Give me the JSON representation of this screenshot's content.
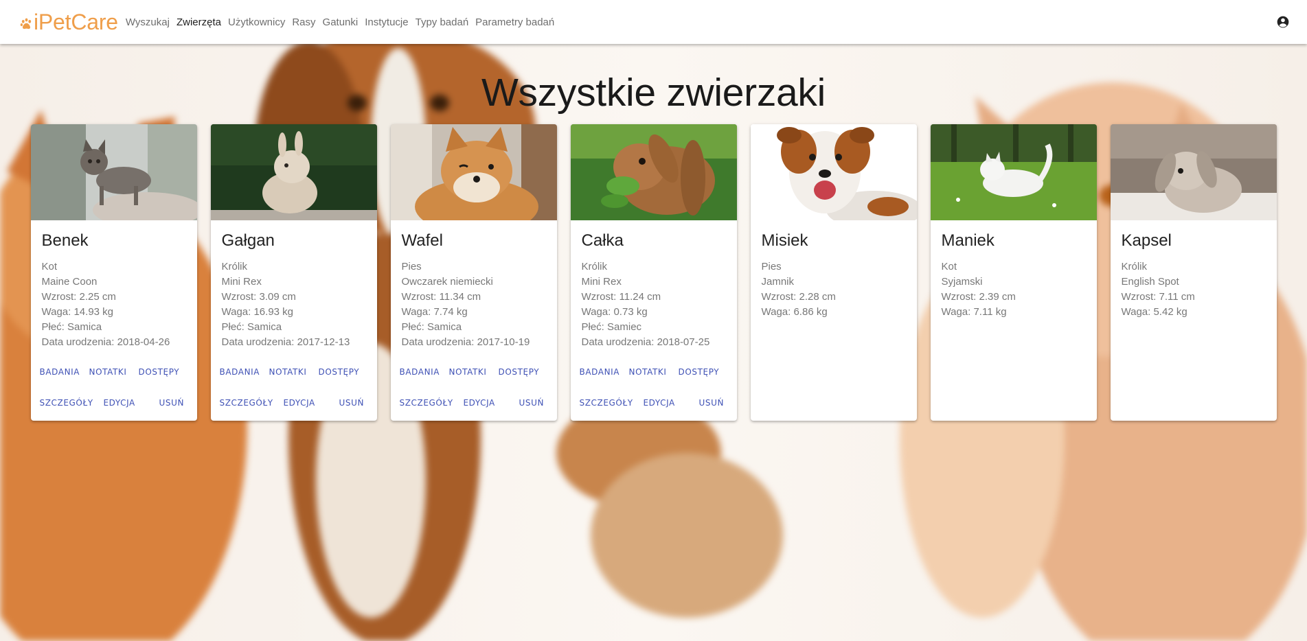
{
  "brand": {
    "name": "iPetCare",
    "icon": "paw-icon",
    "color": "#ef9e4a"
  },
  "nav": {
    "items": [
      {
        "label": "Wyszukaj",
        "active": false
      },
      {
        "label": "Zwierzęta",
        "active": true
      },
      {
        "label": "Użytkownicy",
        "active": false
      },
      {
        "label": "Rasy",
        "active": false
      },
      {
        "label": "Gatunki",
        "active": false
      },
      {
        "label": "Instytucje",
        "active": false
      },
      {
        "label": "Typy badań",
        "active": false
      },
      {
        "label": "Parametry badań",
        "active": false
      }
    ],
    "account_icon": "account-circle-icon"
  },
  "page": {
    "title": "Wszystkie zwierzaki"
  },
  "actions": {
    "tests": "Badania",
    "notes": "Notatki",
    "access": "Dostępy",
    "details": "Szczegóły",
    "edit": "Edycja",
    "delete": "Usuń",
    "color": "#3f51b5"
  },
  "pets": [
    {
      "name": "Benek",
      "species": "Kot",
      "breed": "Maine Coon",
      "height": "Wzrost: 2.25 cm",
      "weight": "Waga: 14.93 kg",
      "sex": "Płeć: Samica",
      "birth": "Data urodzenia: 2018-04-26",
      "photo": "kitten-photo"
    },
    {
      "name": "Gałgan",
      "species": "Królik",
      "breed": "Mini Rex",
      "height": "Wzrost: 3.09 cm",
      "weight": "Waga: 16.93 kg",
      "sex": "Płeć: Samica",
      "birth": "Data urodzenia: 2017-12-13",
      "photo": "white-rabbit-photo"
    },
    {
      "name": "Wafel",
      "species": "Pies",
      "breed": "Owczarek niemiecki",
      "height": "Wzrost: 11.34 cm",
      "weight": "Waga: 7.74 kg",
      "sex": "Płeć: Samica",
      "birth": "Data urodzenia: 2017-10-19",
      "photo": "shiba-photo"
    },
    {
      "name": "Całka",
      "species": "Królik",
      "breed": "Mini Rex",
      "height": "Wzrost: 11.24 cm",
      "weight": "Waga: 0.73 kg",
      "sex": "Płeć: Samiec",
      "birth": "Data urodzenia: 2018-07-25",
      "photo": "brown-rabbit-photo"
    },
    {
      "name": "Misiek",
      "species": "Pies",
      "breed": "Jamnik",
      "height": "Wzrost: 2.28 cm",
      "weight": "Waga: 6.86 kg",
      "sex": "",
      "birth": "",
      "photo": "terrier-photo"
    },
    {
      "name": "Maniek",
      "species": "Kot",
      "breed": "Syjamski",
      "height": "Wzrost: 2.39 cm",
      "weight": "Waga: 7.11 kg",
      "sex": "",
      "birth": "",
      "photo": "white-cat-grass-photo"
    },
    {
      "name": "Kapsel",
      "species": "Królik",
      "breed": "English Spot",
      "height": "Wzrost: 7.11 cm",
      "weight": "Waga: 5.42 kg",
      "sex": "",
      "birth": "",
      "photo": "lop-rabbit-photo"
    }
  ]
}
